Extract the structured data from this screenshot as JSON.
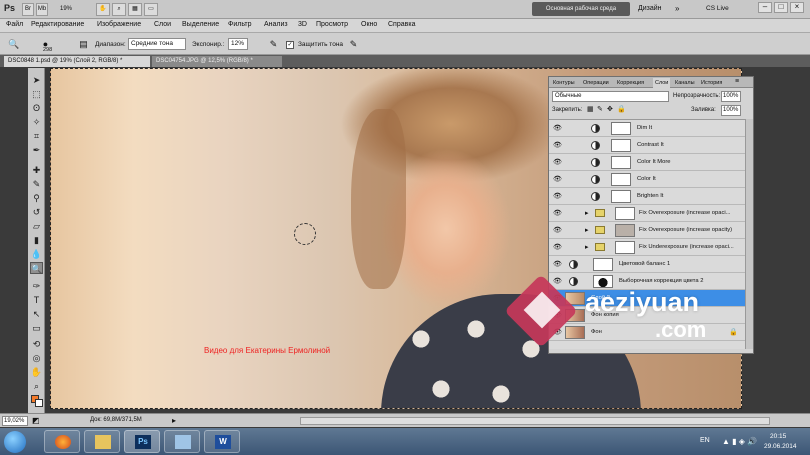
{
  "app": {
    "logo": "Ps",
    "zoom": "19%",
    "workspace": "Основная рабочая среда",
    "design": "Дизайн",
    "cs_live": "CS Live",
    "chevrons": "»"
  },
  "menu": [
    "Файл",
    "Редактирование",
    "Изображение",
    "Слои",
    "Выделение",
    "Фильтр",
    "Анализ",
    "3D",
    "Просмотр",
    "Окно",
    "Справка"
  ],
  "options": {
    "brush_size": "298",
    "range_label": "Диапазон:",
    "range_value": "Средние тона",
    "exposure_label": "Экспонир.:",
    "exposure_value": "12%",
    "protect_label": "Защитить тона"
  },
  "tabs": [
    {
      "label": "DSC0848 1.psd @ 19% (Слой 2, RGB/8) *",
      "active": true
    },
    {
      "label": "DSC04754.JPG @ 12,5% (RGB/8) *",
      "active": false
    }
  ],
  "canvas": {
    "caption": "Видео для Екатерины Ермолиной",
    "watermark": "aeziyuan",
    "watermark_domain": ".com"
  },
  "layers_panel": {
    "tabs": [
      "Контуры",
      "Операции",
      "Коррекция",
      "Слои",
      "Каналы",
      "История"
    ],
    "active_tab": "Слои",
    "blend_mode": "Обычные",
    "opacity_label": "Непрозрачность:",
    "opacity": "100%",
    "lock_label": "Закрепить:",
    "fill_label": "Заливка:",
    "fill": "100%",
    "layers": [
      {
        "name": "Dim It",
        "kind": "adj-nested"
      },
      {
        "name": "Contrast It",
        "kind": "adj-nested"
      },
      {
        "name": "Color It More",
        "kind": "adj-nested"
      },
      {
        "name": "Color It",
        "kind": "adj-nested"
      },
      {
        "name": "Brighten It",
        "kind": "adj-nested"
      },
      {
        "name": "Fix Overexposure (increase opaci...",
        "kind": "group"
      },
      {
        "name": "Fix Overexposure (increase opacity)",
        "kind": "group"
      },
      {
        "name": "Fix Underexposure (increase opaci...",
        "kind": "group"
      },
      {
        "name": "Цветовой баланс 1",
        "kind": "adj"
      },
      {
        "name": "Выборочная коррекция цвета 2",
        "kind": "adj-mask"
      },
      {
        "name": "Слой 2",
        "kind": "photo",
        "selected": true
      },
      {
        "name": "Фон копия",
        "kind": "photo"
      },
      {
        "name": "Фон",
        "kind": "photo"
      }
    ]
  },
  "status": {
    "zoom": "19,02%",
    "doc": "Док: 69,8M/371,5M"
  },
  "taskbar": {
    "lang": "EN",
    "time": "20:15",
    "date": "29.06.2014",
    "apps": [
      "firefox",
      "explorer",
      "photoshop",
      "window",
      "word"
    ]
  },
  "colors": {
    "foreground": "#f37a2a",
    "background": "#ffffff",
    "selection": "#3d8ee6",
    "caption": "#e22222"
  }
}
